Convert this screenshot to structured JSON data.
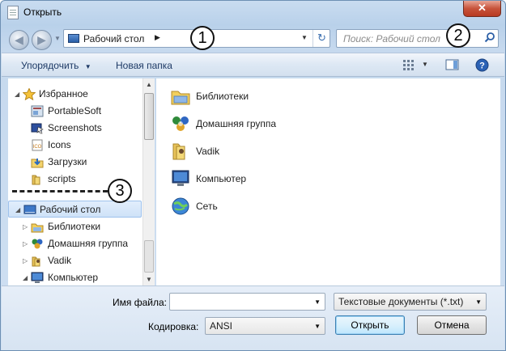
{
  "window": {
    "title": "Открыть",
    "close_glyph": "✕"
  },
  "nav": {
    "back_glyph": "◀",
    "forward_glyph": "▶"
  },
  "address": {
    "location": "Рабочий стол",
    "separator": "▶",
    "dropdown_glyph": "▼",
    "refresh_glyph": "↻"
  },
  "search": {
    "placeholder": "Поиск: Рабочий стол",
    "icon_glyph": "⚲"
  },
  "callouts": [
    "1",
    "2",
    "3"
  ],
  "toolbar": {
    "organize_label": "Упорядочить",
    "organize_arrow": "▼",
    "new_folder_label": "Новая папка",
    "view_arrow": "▼",
    "help_glyph": "?"
  },
  "tree": {
    "expand_open": "◢",
    "expand_closed": "▷",
    "items": [
      {
        "label": "Избранное",
        "icon": "star-icon"
      },
      {
        "label": "PortableSoft",
        "icon": "app-icon"
      },
      {
        "label": "Screenshots",
        "icon": "screenshot-icon"
      },
      {
        "label": "Icons",
        "icon": "ico-icon"
      },
      {
        "label": "Загрузки",
        "icon": "downloads-icon"
      },
      {
        "label": "scripts",
        "icon": "folder-icon"
      },
      {
        "label": "Рабочий стол",
        "icon": "desktop-icon"
      },
      {
        "label": "Библиотеки",
        "icon": "libraries-icon"
      },
      {
        "label": "Домашняя группа",
        "icon": "homegroup-icon"
      },
      {
        "label": "Vadik",
        "icon": "user-folder-icon"
      },
      {
        "label": "Компьютер",
        "icon": "computer-icon"
      }
    ]
  },
  "content": {
    "items": [
      {
        "label": "Библиотеки",
        "icon": "libraries-icon"
      },
      {
        "label": "Домашняя группа",
        "icon": "homegroup-icon"
      },
      {
        "label": "Vadik",
        "icon": "user-folder-icon"
      },
      {
        "label": "Компьютер",
        "icon": "computer-icon"
      },
      {
        "label": "Сеть",
        "icon": "network-icon"
      }
    ]
  },
  "bottom": {
    "filename_label": "Имя файла:",
    "filename_value": "",
    "filetype_value": "Текстовые документы (*.txt)",
    "encoding_label": "Кодировка:",
    "encoding_value": "ANSI",
    "open_label": "Открыть",
    "cancel_label": "Отмена",
    "dropdown_glyph": "▼"
  },
  "colors": {
    "accent": "#3c7fb1",
    "toolbar_text": "#1e3a66",
    "selection": "#cfe2f8"
  }
}
